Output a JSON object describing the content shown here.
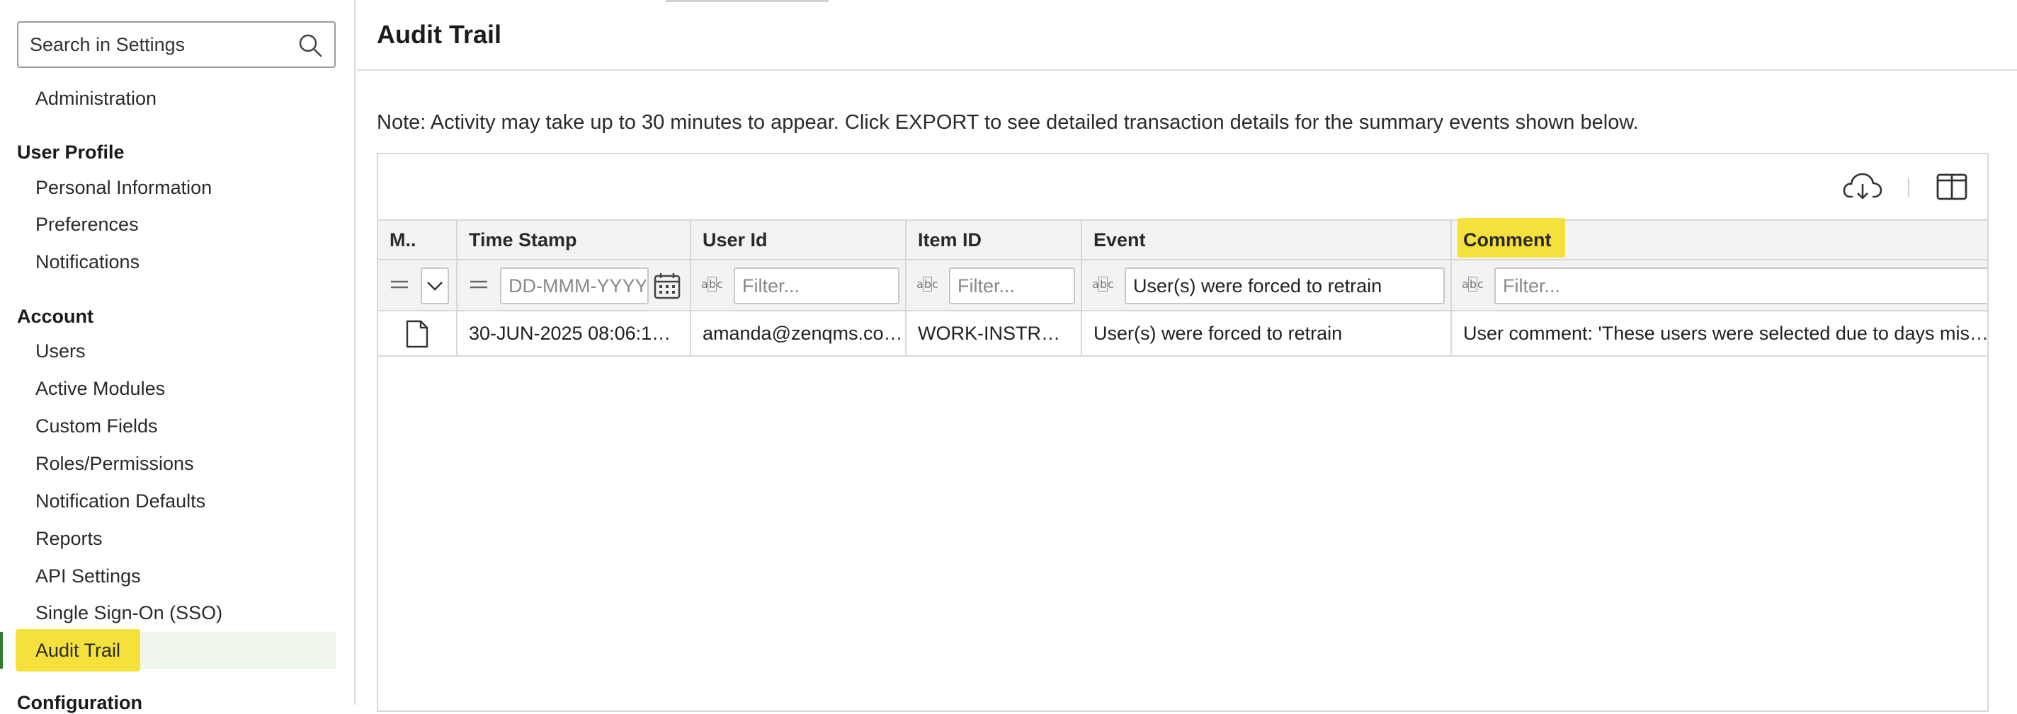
{
  "sidebar": {
    "search": {
      "placeholder": "Search in Settings"
    },
    "administration": "Administration",
    "user_profile": {
      "heading": "User Profile",
      "items": [
        "Personal Information",
        "Preferences",
        "Notifications"
      ]
    },
    "account": {
      "heading": "Account",
      "items": [
        "Users",
        "Active Modules",
        "Custom Fields",
        "Roles/Permissions",
        "Notification Defaults",
        "Reports",
        "API Settings",
        "Single Sign-On (SSO)",
        "Audit Trail"
      ],
      "active": "Audit Trail"
    },
    "configuration": {
      "heading": "Configuration"
    }
  },
  "main": {
    "title": "Audit Trail",
    "note": "Note: Activity may take up to 30 minutes to appear. Click EXPORT to see detailed transaction details for the summary events shown below.",
    "toolbar": {
      "export_icon": "cloud-download-icon",
      "columns_icon": "columns-icon"
    },
    "table": {
      "columns": [
        "M..",
        "Time Stamp",
        "User Id",
        "Item ID",
        "Event",
        "Comment"
      ],
      "filters": {
        "timestamp_placeholder": "DD-MMM-YYYY",
        "user_id_placeholder": "Filter...",
        "item_id_placeholder": "Filter...",
        "event_value": "User(s) were forced to retrain",
        "comment_placeholder": "Filter..."
      },
      "rows": [
        {
          "icon": "document-icon",
          "timestamp": "30-JUN-2025 08:06:1…",
          "user_id": "amanda@zenqms.co…",
          "item_id": "WORK-INSTR…",
          "event": "User(s) were forced to retrain",
          "comment": "User comment: 'These users were selected due to days mis…"
        }
      ]
    }
  },
  "colors": {
    "highlight": "#f5e13c",
    "active_bg": "#eef6ec",
    "active_bar": "#2e7d32"
  }
}
